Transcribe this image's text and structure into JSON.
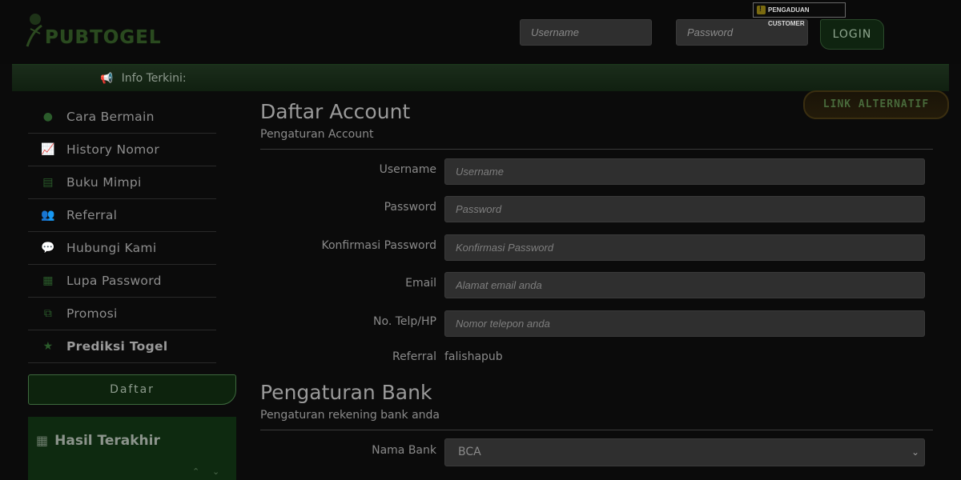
{
  "header": {
    "logo_text": "PUBTOGEL",
    "username_placeholder": "Username",
    "password_placeholder": "Password",
    "login_label": "LOGIN",
    "complaint_label": "PENGADUAN CUSTOMER"
  },
  "info_bar": {
    "label": "Info Terkini:"
  },
  "link_alternatif": "LINK ALTERNATIF",
  "sidebar": {
    "items": [
      {
        "label": "Cara Bermain",
        "icon": "question-circle-icon"
      },
      {
        "label": "History Nomor",
        "icon": "line-chart-icon"
      },
      {
        "label": "Buku Mimpi",
        "icon": "book-icon"
      },
      {
        "label": "Referral",
        "icon": "users-icon"
      },
      {
        "label": "Hubungi Kami",
        "icon": "chat-bubbles-icon"
      },
      {
        "label": "Lupa Password",
        "icon": "calendar-icon"
      },
      {
        "label": "Promosi",
        "icon": "gift-icon"
      },
      {
        "label": "Prediksi Togel",
        "icon": "star-icon"
      }
    ],
    "daftar_label": "Daftar",
    "hasil_title": "Hasil Terakhir"
  },
  "main": {
    "account_title": "Daftar Account",
    "account_subtitle": "Pengaturan Account",
    "fields": {
      "username": {
        "label": "Username",
        "placeholder": "Username"
      },
      "password": {
        "label": "Password",
        "placeholder": "Password"
      },
      "confirm": {
        "label": "Konfirmasi Password",
        "placeholder": "Konfirmasi Password"
      },
      "email": {
        "label": "Email",
        "placeholder": "Alamat email anda"
      },
      "phone": {
        "label": "No. Telp/HP",
        "placeholder": "Nomor telepon anda"
      },
      "referral": {
        "label": "Referral",
        "value": "falishapub"
      }
    },
    "bank_title": "Pengaturan Bank",
    "bank_subtitle": "Pengaturan rekening bank anda",
    "bank_field": {
      "label": "Nama Bank",
      "value": "BCA"
    }
  }
}
